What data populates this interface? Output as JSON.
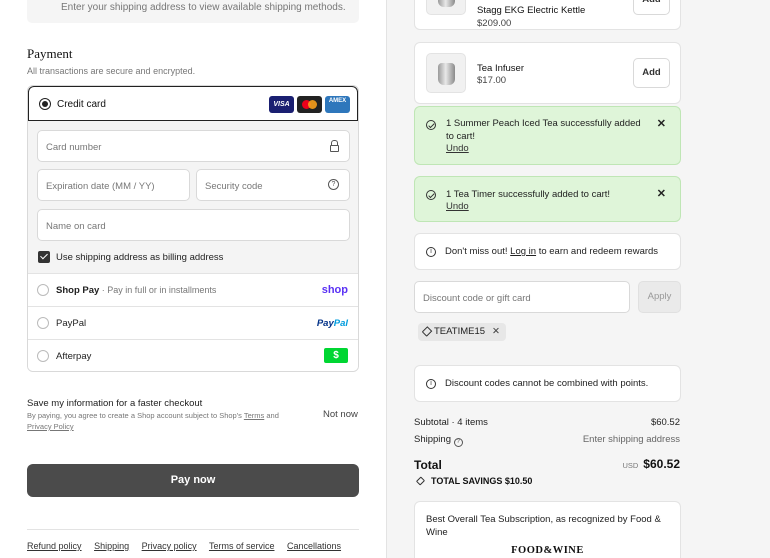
{
  "shipping_hint": "Enter your shipping address to view available shipping methods.",
  "payment": {
    "title": "Payment",
    "subtitle": "All transactions are secure and encrypted.",
    "credit_card_label": "Credit card",
    "card_brands": [
      "VISA",
      "AMEX"
    ],
    "card_number_placeholder": "Card number",
    "expiration_placeholder": "Expiration date (MM / YY)",
    "security_code_placeholder": "Security code",
    "name_on_card_placeholder": "Name on card",
    "billing_checkbox_label": "Use shipping address as billing address",
    "billing_checked": true,
    "methods": {
      "shop_pay": {
        "label": "Shop Pay",
        "sub": " · Pay in full or in installments",
        "logo": "shop"
      },
      "paypal": {
        "label": "PayPal",
        "logo_a": "Pay",
        "logo_b": "Pal"
      },
      "afterpay": {
        "label": "Afterpay",
        "logo": "$"
      }
    }
  },
  "save_info": {
    "title": "Save my information for a faster checkout",
    "text_a": "By paying, you agree to create a Shop account subject to Shop's ",
    "terms": "Terms",
    "text_b": " and ",
    "privacy": "Privacy Policy",
    "not_now": "Not now"
  },
  "pay_now_label": "Pay now",
  "footer_links": [
    "Refund policy",
    "Shipping",
    "Privacy policy",
    "Terms of service",
    "Cancellations"
  ],
  "upsell": [
    {
      "name": "Stagg EKG Electric Kettle",
      "price": "$209.00",
      "add_label": "Add"
    },
    {
      "name": "Tea Infuser",
      "price": "$17.00",
      "add_label": "Add"
    }
  ],
  "toasts": [
    {
      "text": "1 Summer Peach Iced Tea successfully added to cart!",
      "undo": "Undo",
      "close": "✕"
    },
    {
      "text": "1 Tea Timer successfully added to cart!",
      "undo": "Undo",
      "close": "✕"
    }
  ],
  "rewards": {
    "prefix": "Don't miss out! ",
    "link": "Log in",
    "suffix": " to earn and redeem rewards"
  },
  "discount": {
    "placeholder": "Discount code or gift card",
    "apply_label": "Apply"
  },
  "applied_code": {
    "code": "TEATIME15",
    "remove": "✕"
  },
  "points_notice": "Discount codes cannot be combined with points.",
  "summary": {
    "subtotal_label": "Subtotal · 4 items",
    "subtotal_value": "$60.52",
    "shipping_label": "Shipping",
    "shipping_value": "Enter shipping address",
    "total_label": "Total",
    "currency": "USD",
    "total_value": "$60.52",
    "savings_label": "TOTAL SAVINGS",
    "savings_value": "$10.50"
  },
  "promo": {
    "text": "Best Overall Tea Subscription, as recognized by Food & Wine",
    "logo": "FOOD&WINE"
  }
}
